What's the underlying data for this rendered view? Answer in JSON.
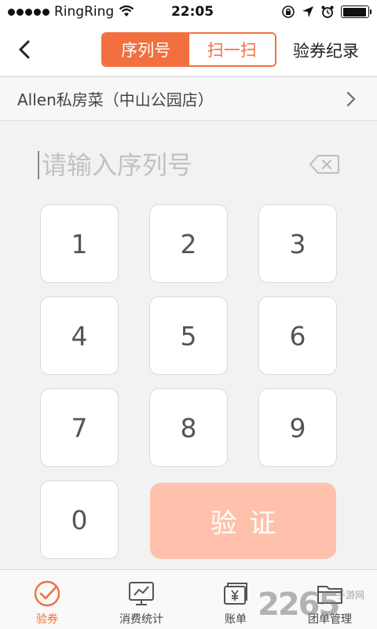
{
  "status_bar": {
    "carrier": "RingRing",
    "time": "22:05",
    "battery_level": 0.95
  },
  "nav": {
    "back_icon": "chevron-left-icon",
    "tabs": [
      {
        "label": "序列号",
        "active": true
      },
      {
        "label": "扫一扫",
        "active": false
      }
    ],
    "history_label": "验券纪录"
  },
  "store": {
    "name": "Allen私房菜（中山公园店）"
  },
  "serial_input": {
    "value": "",
    "placeholder": "请输入序列号"
  },
  "keypad": {
    "keys": [
      "1",
      "2",
      "3",
      "4",
      "5",
      "6",
      "7",
      "8",
      "9",
      "0"
    ],
    "verify_label": "验证"
  },
  "tab_bar": {
    "items": [
      {
        "label": "验券",
        "icon": "check-circle-icon",
        "active": true
      },
      {
        "label": "消费统计",
        "icon": "chart-icon",
        "active": false
      },
      {
        "label": "账单",
        "icon": "bill-icon",
        "active": false
      },
      {
        "label": "团单管理",
        "icon": "folder-icon",
        "active": false
      }
    ]
  },
  "watermark": {
    "number": "2265",
    "text": "手游网"
  },
  "colors": {
    "accent": "#f2703f",
    "verify_disabled": "#ffc1ab",
    "background": "#f2f2f2"
  }
}
